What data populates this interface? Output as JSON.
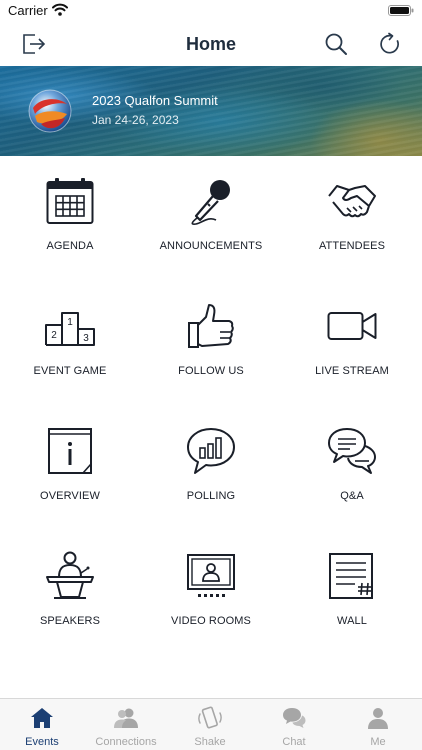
{
  "status_bar": {
    "carrier": "Carrier"
  },
  "nav": {
    "title": "Home"
  },
  "banner": {
    "title": "2023 Qualfon Summit",
    "date": "Jan 24-26, 2023"
  },
  "tiles": [
    {
      "label": "AGENDA",
      "icon": "calendar-icon"
    },
    {
      "label": "ANNOUNCEMENTS",
      "icon": "microphone-icon"
    },
    {
      "label": "ATTENDEES",
      "icon": "handshake-icon"
    },
    {
      "label": "EVENT GAME",
      "icon": "podium-icon"
    },
    {
      "label": "FOLLOW US",
      "icon": "thumbs-up-icon"
    },
    {
      "label": "LIVE STREAM",
      "icon": "video-camera-icon"
    },
    {
      "label": "OVERVIEW",
      "icon": "info-icon"
    },
    {
      "label": "POLLING",
      "icon": "poll-chart-icon"
    },
    {
      "label": "Q&A",
      "icon": "chat-bubbles-icon"
    },
    {
      "label": "SPEAKERS",
      "icon": "speaker-lectern-icon"
    },
    {
      "label": "VIDEO ROOMS",
      "icon": "video-room-icon"
    },
    {
      "label": "WALL",
      "icon": "wall-post-icon"
    }
  ],
  "podium_numbers": {
    "first": "1",
    "second": "2",
    "third": "3"
  },
  "tabs": [
    {
      "label": "Events",
      "icon": "home-icon",
      "active": true
    },
    {
      "label": "Connections",
      "icon": "people-icon",
      "active": false
    },
    {
      "label": "Shake",
      "icon": "shake-phone-icon",
      "active": false
    },
    {
      "label": "Chat",
      "icon": "chat-icon",
      "active": false
    },
    {
      "label": "Me",
      "icon": "person-icon",
      "active": false
    }
  ],
  "colors": {
    "nav_title": "#1f2d3d",
    "icon_stroke": "#1a1f29",
    "tab_active": "#1c3f73",
    "tab_inactive": "#a6a6a6",
    "accent_blue": "#3b78c2"
  }
}
